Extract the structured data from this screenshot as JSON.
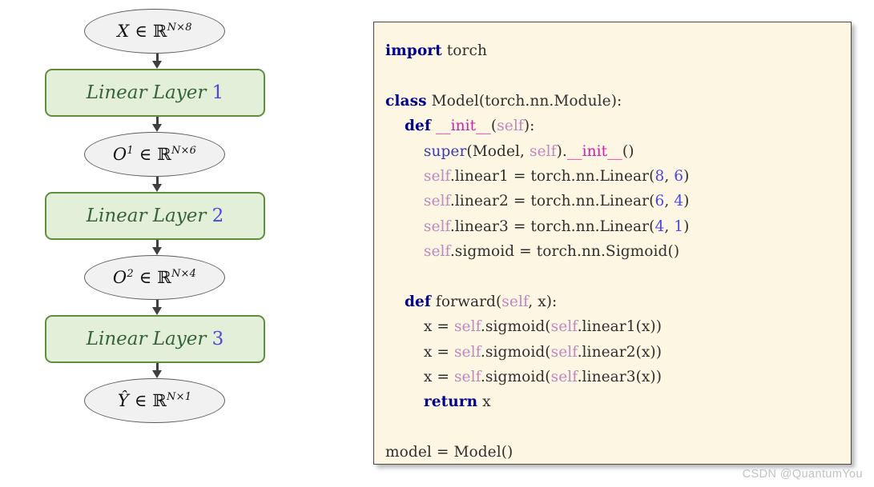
{
  "diagram": {
    "nodes": [
      {
        "kind": "ellipse",
        "name": "input-tensor",
        "var": "X",
        "sup": "",
        "set": "ℝ",
        "dims": "N×8"
      },
      {
        "kind": "box",
        "name": "linear-layer-1",
        "text": "Linear Layer",
        "num": "1"
      },
      {
        "kind": "ellipse",
        "name": "output-1-tensor",
        "var": "O",
        "sup": "1",
        "set": "ℝ",
        "dims": "N×6"
      },
      {
        "kind": "box",
        "name": "linear-layer-2",
        "text": "Linear Layer",
        "num": "2"
      },
      {
        "kind": "ellipse",
        "name": "output-2-tensor",
        "var": "O",
        "sup": "2",
        "set": "ℝ",
        "dims": "N×4"
      },
      {
        "kind": "box",
        "name": "linear-layer-3",
        "text": "Linear Layer",
        "num": "3"
      },
      {
        "kind": "ellipse",
        "name": "prediction-tensor",
        "var": "Ŷ",
        "sup": "",
        "set": "ℝ",
        "dims": "N×1"
      }
    ],
    "member_symbol": "∈",
    "colors": {
      "ellipse_fill": "#f1f1f1",
      "ellipse_border": "#5b5b5b",
      "box_fill": "#e3efd9",
      "box_border": "#5e8f3e",
      "box_text": "#37633a",
      "arrow": "#3f3f3f"
    }
  },
  "code": {
    "language": "python",
    "panel_background": "#fdf6e3",
    "lines": [
      [
        {
          "t": "import",
          "c": "kw"
        },
        {
          "t": " torch",
          "c": "pl"
        }
      ],
      [
        {
          "t": "",
          "c": "pl"
        }
      ],
      [
        {
          "t": "class",
          "c": "kw"
        },
        {
          "t": " Model(torch.nn.Module):",
          "c": "pl"
        }
      ],
      [
        {
          "t": "    ",
          "c": "pl"
        },
        {
          "t": "def",
          "c": "kw"
        },
        {
          "t": " ",
          "c": "pl"
        },
        {
          "t": "__init__",
          "c": "dun"
        },
        {
          "t": "(",
          "c": "pl"
        },
        {
          "t": "self",
          "c": "slf"
        },
        {
          "t": "):",
          "c": "pl"
        }
      ],
      [
        {
          "t": "        ",
          "c": "pl"
        },
        {
          "t": "super",
          "c": "bi"
        },
        {
          "t": "(Model, ",
          "c": "pl"
        },
        {
          "t": "self",
          "c": "slf"
        },
        {
          "t": ").",
          "c": "pl"
        },
        {
          "t": "__init__",
          "c": "dun"
        },
        {
          "t": "()",
          "c": "pl"
        }
      ],
      [
        {
          "t": "        ",
          "c": "pl"
        },
        {
          "t": "self",
          "c": "slf"
        },
        {
          "t": ".linear1 = torch.nn.Linear(",
          "c": "pl"
        },
        {
          "t": "8",
          "c": "num"
        },
        {
          "t": ", ",
          "c": "pl"
        },
        {
          "t": "6",
          "c": "num"
        },
        {
          "t": ")",
          "c": "pl"
        }
      ],
      [
        {
          "t": "        ",
          "c": "pl"
        },
        {
          "t": "self",
          "c": "slf"
        },
        {
          "t": ".linear2 = torch.nn.Linear(",
          "c": "pl"
        },
        {
          "t": "6",
          "c": "num"
        },
        {
          "t": ", ",
          "c": "pl"
        },
        {
          "t": "4",
          "c": "num"
        },
        {
          "t": ")",
          "c": "pl"
        }
      ],
      [
        {
          "t": "        ",
          "c": "pl"
        },
        {
          "t": "self",
          "c": "slf"
        },
        {
          "t": ".linear3 = torch.nn.Linear(",
          "c": "pl"
        },
        {
          "t": "4",
          "c": "num"
        },
        {
          "t": ", ",
          "c": "pl"
        },
        {
          "t": "1",
          "c": "num"
        },
        {
          "t": ")",
          "c": "pl"
        }
      ],
      [
        {
          "t": "        ",
          "c": "pl"
        },
        {
          "t": "self",
          "c": "slf"
        },
        {
          "t": ".sigmoid = torch.nn.Sigmoid()",
          "c": "pl"
        }
      ],
      [
        {
          "t": "",
          "c": "pl"
        }
      ],
      [
        {
          "t": "    ",
          "c": "pl"
        },
        {
          "t": "def",
          "c": "kw"
        },
        {
          "t": " forward(",
          "c": "pl"
        },
        {
          "t": "self",
          "c": "slf"
        },
        {
          "t": ", x):",
          "c": "pl"
        }
      ],
      [
        {
          "t": "        x = ",
          "c": "pl"
        },
        {
          "t": "self",
          "c": "slf"
        },
        {
          "t": ".sigmoid(",
          "c": "pl"
        },
        {
          "t": "self",
          "c": "slf"
        },
        {
          "t": ".linear1(x))",
          "c": "pl"
        }
      ],
      [
        {
          "t": "        x = ",
          "c": "pl"
        },
        {
          "t": "self",
          "c": "slf"
        },
        {
          "t": ".sigmoid(",
          "c": "pl"
        },
        {
          "t": "self",
          "c": "slf"
        },
        {
          "t": ".linear2(x))",
          "c": "pl"
        }
      ],
      [
        {
          "t": "        x = ",
          "c": "pl"
        },
        {
          "t": "self",
          "c": "slf"
        },
        {
          "t": ".sigmoid(",
          "c": "pl"
        },
        {
          "t": "self",
          "c": "slf"
        },
        {
          "t": ".linear3(x))",
          "c": "pl"
        }
      ],
      [
        {
          "t": "        ",
          "c": "pl"
        },
        {
          "t": "return",
          "c": "kw"
        },
        {
          "t": " x",
          "c": "pl"
        }
      ],
      [
        {
          "t": "",
          "c": "pl"
        }
      ],
      [
        {
          "t": "model = Model()",
          "c": "pl"
        }
      ]
    ]
  },
  "watermark": {
    "text": "CSDN @QuantumYou"
  }
}
